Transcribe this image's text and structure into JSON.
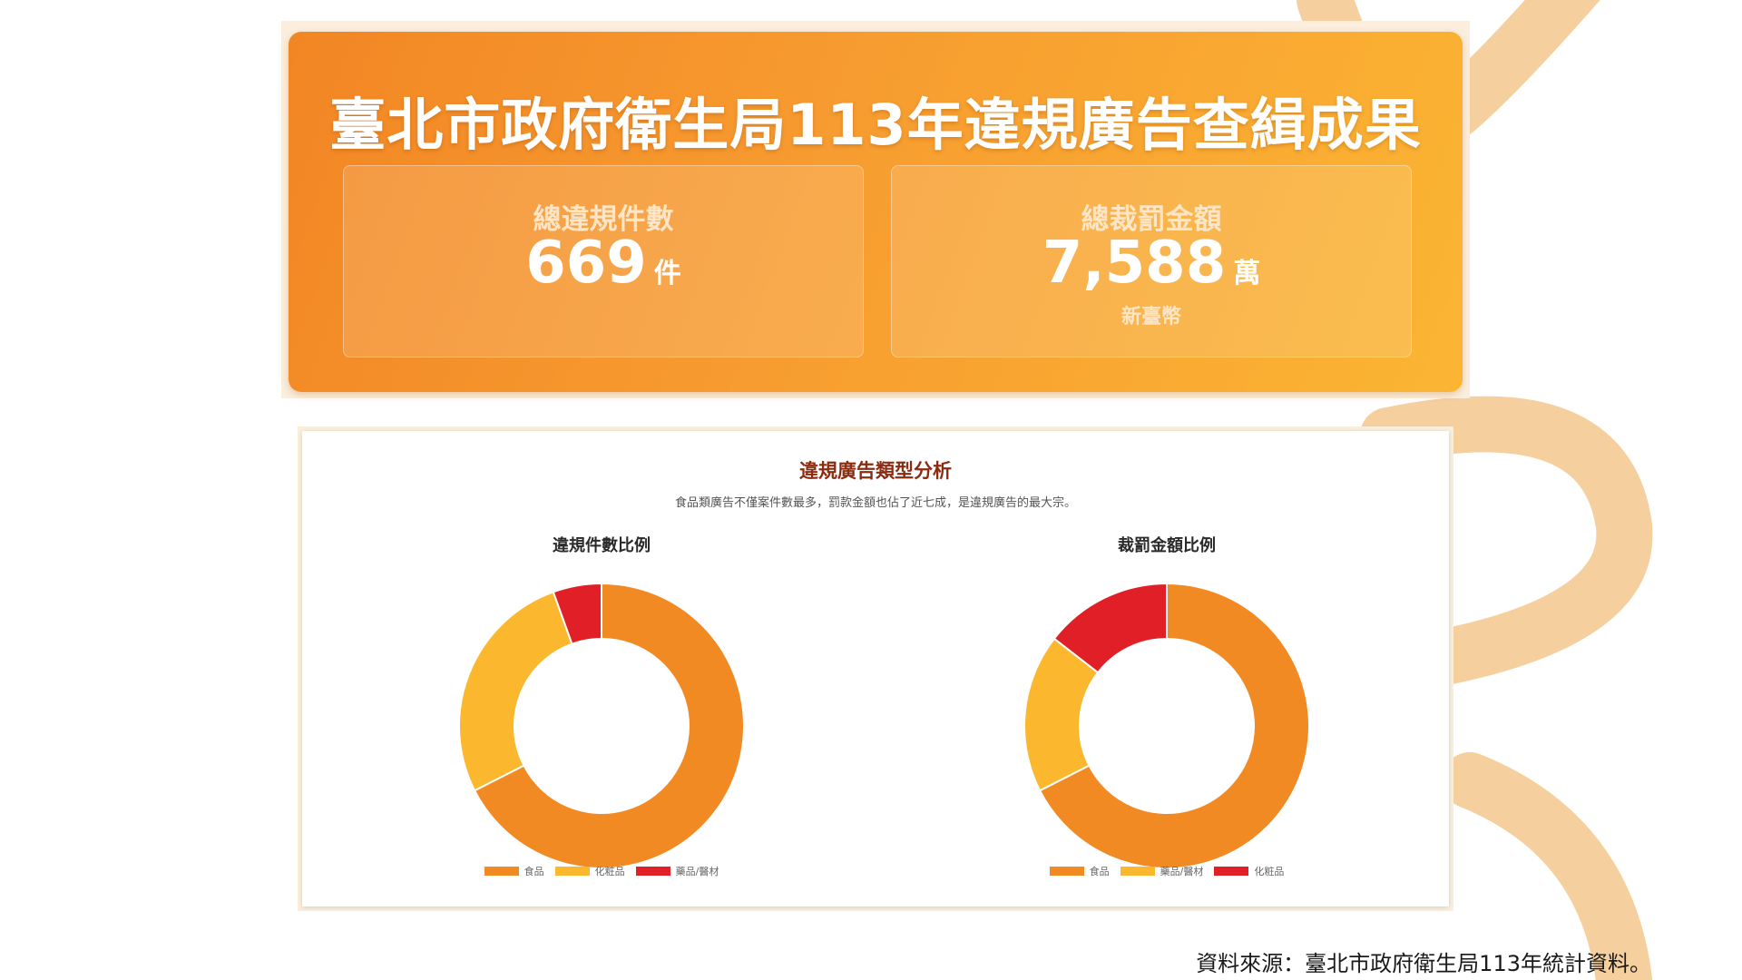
{
  "header": {
    "title": "臺北市政府衛生局113年違規廣告查緝成果",
    "stats": [
      {
        "label": "總違規件數",
        "value": "669",
        "unit": "件",
        "sub": ""
      },
      {
        "label": "總裁罰金額",
        "value": "7,588",
        "unit": "萬",
        "sub": "新臺幣"
      }
    ]
  },
  "section": {
    "title": "違規廣告類型分析",
    "subtitle": "食品類廣告不僅案件數最多，罰款金額也佔了近七成，是違規廣告的最大宗。"
  },
  "source": "資料來源：臺北市政府衛生局113年統計資料。",
  "colors": {
    "food": "#f28a24",
    "cosmetics": "#fbb82f",
    "drugs": "#e01f26",
    "header_start": "#f28624",
    "header_end": "#fbb533",
    "accent_deco": "#f6cf9e"
  },
  "chart_data": [
    {
      "type": "pie",
      "title": "違規件數比例",
      "labels": [
        "食品",
        "化粧品",
        "藥品/醫材"
      ],
      "values": [
        67.5,
        27,
        5.5
      ],
      "colors": [
        "#f28a24",
        "#fbb82f",
        "#e01f26"
      ],
      "legend_position": "bottom"
    },
    {
      "type": "pie",
      "title": "裁罰金額比例",
      "labels": [
        "食品",
        "藥品/醫材",
        "化粧品"
      ],
      "values": [
        67.5,
        18,
        14.5
      ],
      "colors": [
        "#f28a24",
        "#fbb82f",
        "#e01f26"
      ],
      "legend_position": "bottom"
    }
  ]
}
